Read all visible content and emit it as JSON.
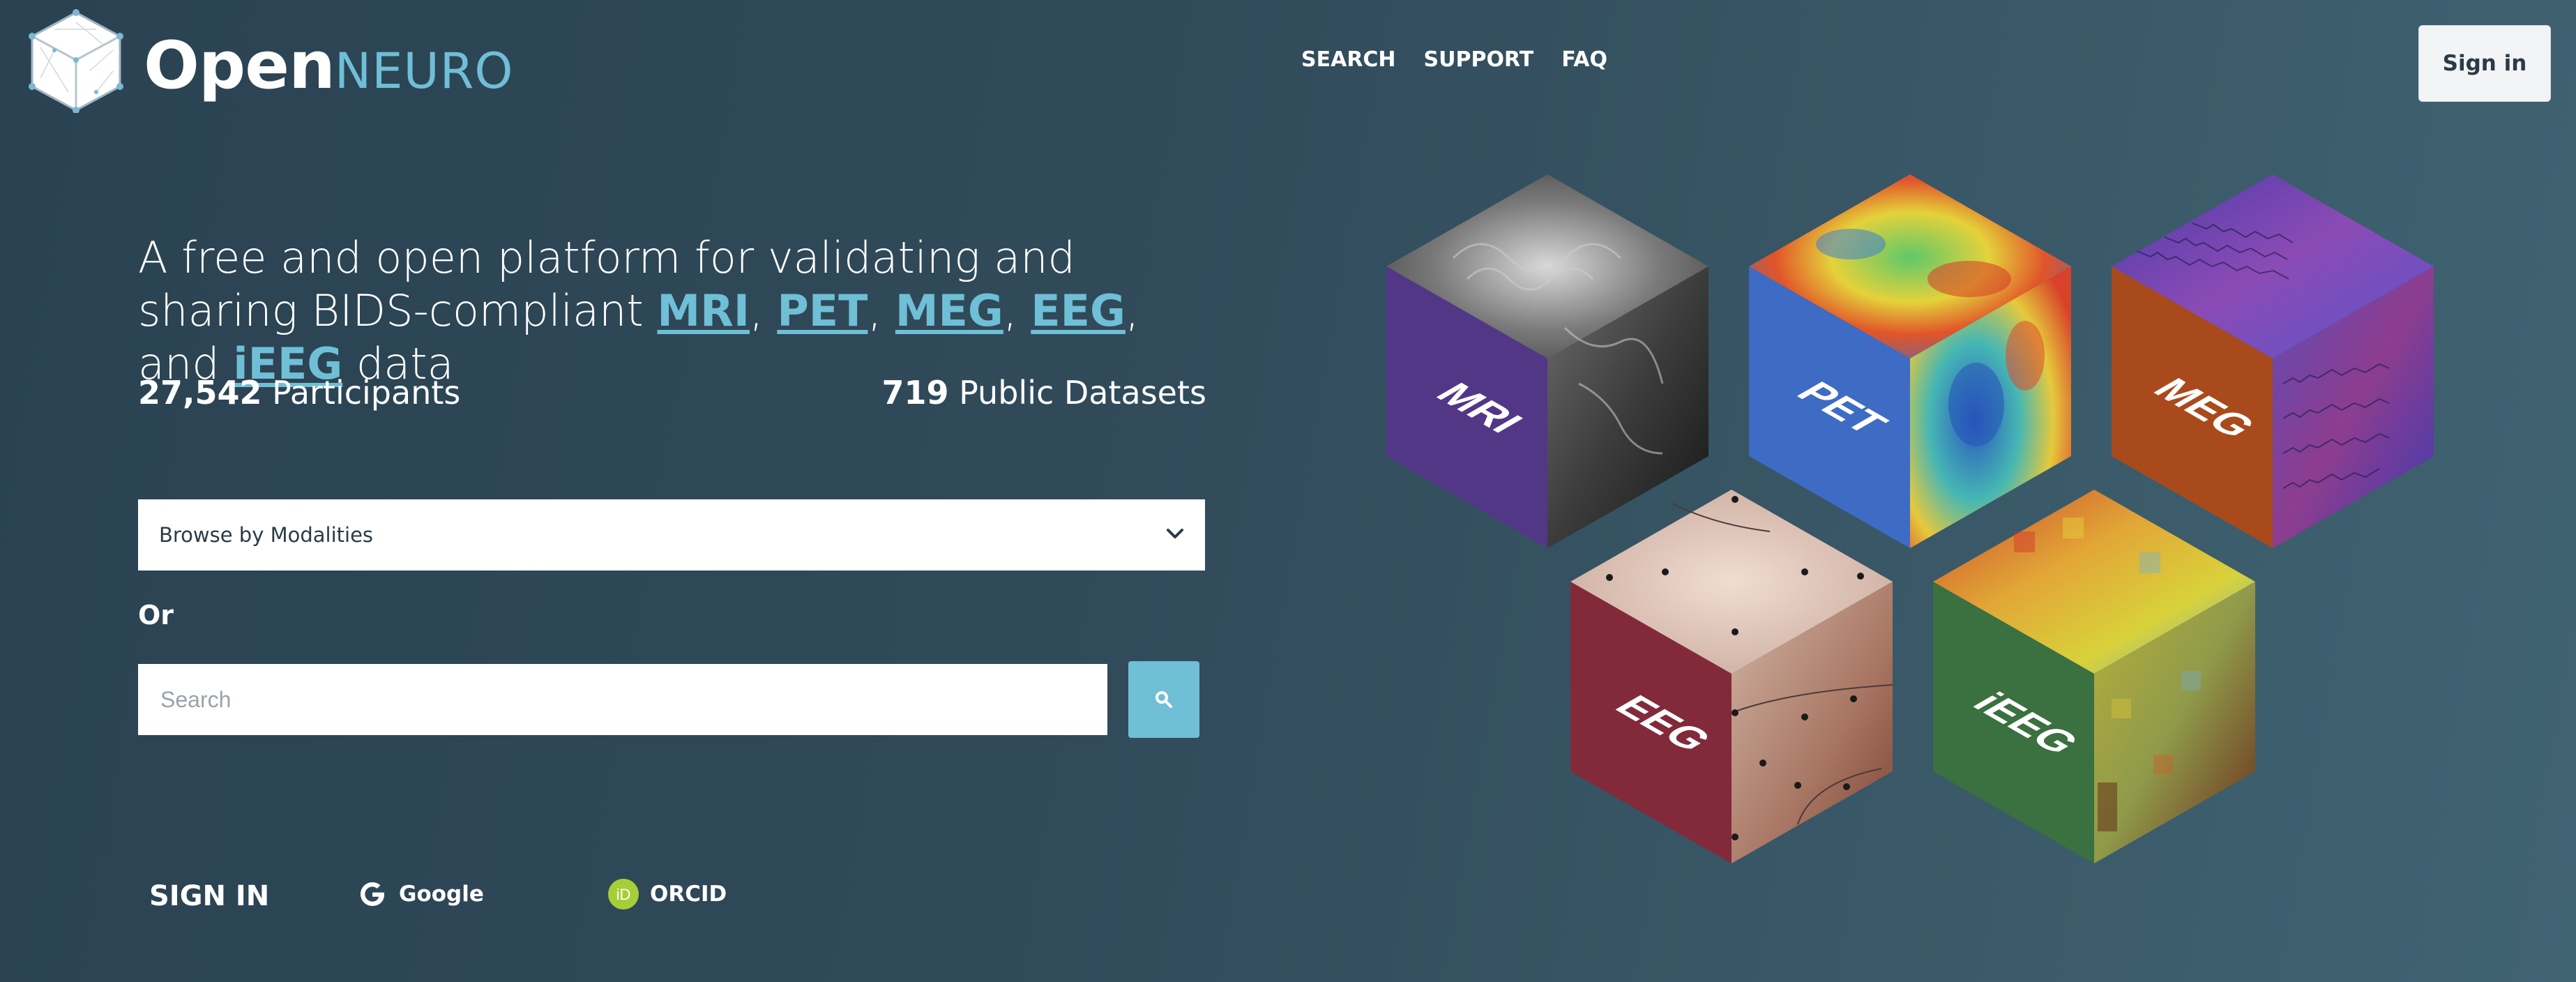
{
  "brand": {
    "open": "Open",
    "neuro": "NEURO"
  },
  "nav": {
    "items": [
      "SEARCH",
      "SUPPORT",
      "FAQ"
    ],
    "sign_in": "Sign in"
  },
  "hero": {
    "tagline_prefix": "A free and open platform for validating and sharing BIDS-compliant ",
    "links": [
      "MRI",
      "PET",
      "MEG",
      "EEG",
      "iEEG"
    ],
    "sep1": ", ",
    "sep2": ", ",
    "sep3": ", ",
    "sep4": ", and ",
    "tagline_suffix": " data",
    "participants_count": "27,542",
    "participants_label": "Participants",
    "datasets_count": "719",
    "datasets_label": "Public Datasets"
  },
  "browse": {
    "label": "Browse by Modalities"
  },
  "or_label": "Or",
  "search": {
    "placeholder": "Search"
  },
  "signin": {
    "label": "SIGN IN",
    "providers": [
      "Google",
      "ORCID"
    ]
  },
  "cubes": [
    {
      "label": "MRI",
      "side_color": "#523787"
    },
    {
      "label": "PET",
      "side_color": "#3e6bc4"
    },
    {
      "label": "MEG",
      "side_color": "#a94a1c"
    },
    {
      "label": "EEG",
      "side_color": "#822a3a"
    },
    {
      "label": "iEEG",
      "side_color": "#3b7040"
    }
  ],
  "colors": {
    "accent": "#6fbfd6",
    "background": "#314b5b"
  },
  "icons": [
    "logo-cube-icon",
    "chevron-down-icon",
    "search-icon",
    "google-icon",
    "orcid-icon"
  ]
}
